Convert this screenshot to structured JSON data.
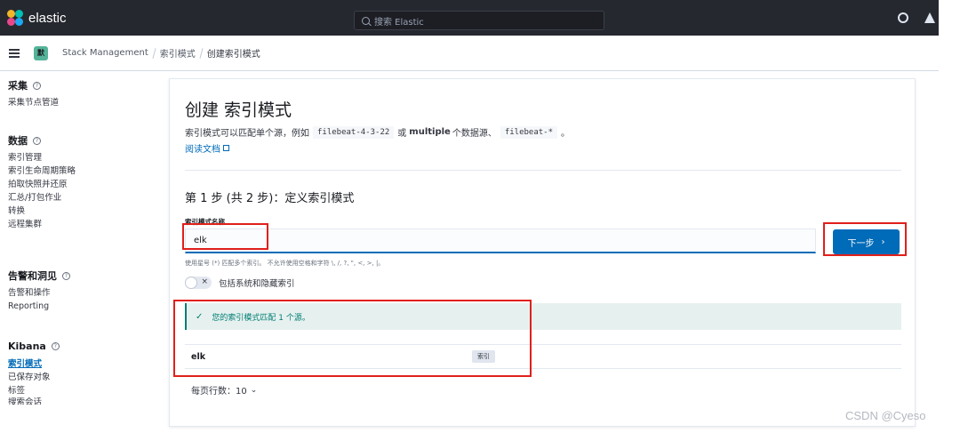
{
  "app": {
    "brand": "elastic",
    "search_placeholder": "搜索 Elastic"
  },
  "breadcrumb": {
    "space_initial": "默",
    "items": [
      "Stack Management",
      "索引模式",
      "创建索引模式"
    ]
  },
  "sidebar": {
    "groups": [
      {
        "title": "采集",
        "items": [
          {
            "label": "采集节点管道",
            "active": false
          }
        ]
      },
      {
        "title": "数据",
        "items": [
          {
            "label": "索引管理",
            "active": false
          },
          {
            "label": "索引生命周期策略",
            "active": false
          },
          {
            "label": "拍取快照并还原",
            "active": false
          },
          {
            "label": "汇总/打包作业",
            "active": false
          },
          {
            "label": "转换",
            "active": false
          },
          {
            "label": "远程集群",
            "active": false
          }
        ]
      },
      {
        "title": "告警和洞见",
        "items": [
          {
            "label": "告警和操作",
            "active": false
          },
          {
            "label": "Reporting",
            "active": false
          }
        ]
      },
      {
        "title": "Kibana",
        "items": [
          {
            "label": "索引模式",
            "active": true
          },
          {
            "label": "已保存对象",
            "active": false
          },
          {
            "label": "标签",
            "active": false
          },
          {
            "label": "搜索会话",
            "active": false
          }
        ]
      }
    ]
  },
  "main": {
    "title": "创建 索引模式",
    "desc_part1": "索引模式可以匹配单个源，例如",
    "code1": "filebeat-4-3-22",
    "desc_part2": "或",
    "desc_bold": "multiple",
    "desc_part3": "个数据源、",
    "code2": "filebeat-*",
    "desc_part4": "。",
    "doc_link": "阅读文档",
    "step_title": "第 1 步 (共 2 步)：定义索引模式",
    "field_label": "索引模式名称",
    "field_value": "elk",
    "next_button": "下一步",
    "help_text": "使用星号 (*) 匹配多个索引。 不允许使用空格和字符 \\, /, ?, \", <, >, |。",
    "toggle_label": "包括系统和隐藏索引",
    "callout": "您的索引模式匹配 1 个源。",
    "result_name": "elk",
    "result_badge": "索引",
    "rows_per_page": "每页行数：10"
  },
  "watermark": "CSDN @Cyeso",
  "colors": {
    "accent": "#006bb8",
    "annotation": "#e0201b",
    "success": "#017d73"
  }
}
